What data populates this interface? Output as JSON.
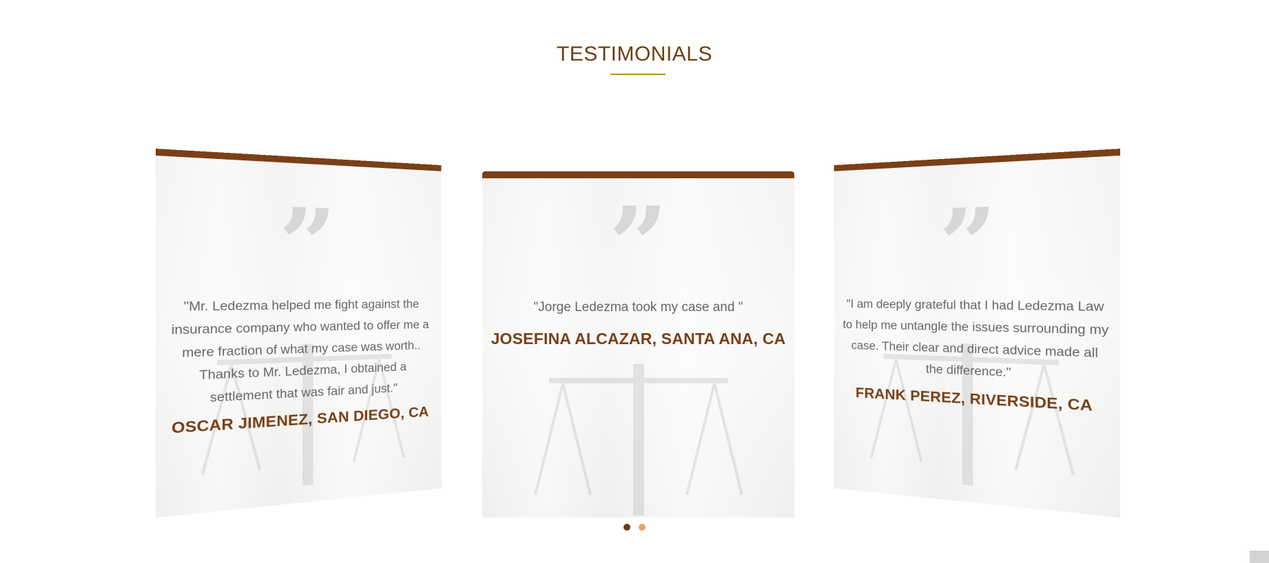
{
  "section": {
    "title": "TESTIMONIALS"
  },
  "testimonials": [
    {
      "quote": "\"Mr. Ledezma helped me fight against the insurance company who wanted to offer me a mere fraction of what my case was worth.. Thanks to Mr. Ledezma, I obtained a settlement that was fair and just.\"",
      "author": "OSCAR JIMENEZ, SAN DIEGO, CA"
    },
    {
      "quote": "\"Jorge Ledezma took my case and \"",
      "author": "JOSEFINA ALCAZAR, SANTA ANA, CA"
    },
    {
      "quote": "\"I am deeply grateful that I had Ledezma Law to help me untangle the issues surrounding my case. Their clear and direct advice made all the difference.\"",
      "author": "FRANK PEREZ, RIVERSIDE, CA"
    }
  ],
  "quote_glyph": "”",
  "carousel": {
    "active_dot": 1,
    "dot_count": 2
  },
  "colors": {
    "accent": "#7a3f17",
    "title": "#6b3f12",
    "underline": "#b79021",
    "dot_active": "#6b3a17",
    "dot_inactive": "#e9a463"
  }
}
